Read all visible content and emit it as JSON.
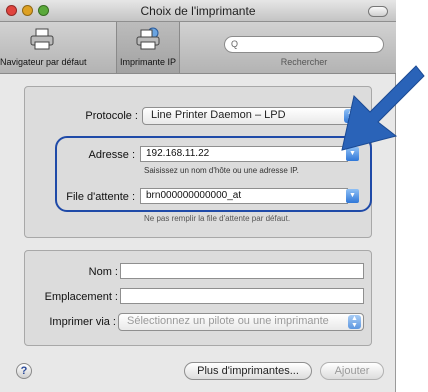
{
  "window": {
    "title": "Choix de l'imprimante"
  },
  "toolbar": {
    "default_browser_label": "Navigateur par défaut",
    "ip_printer_label": "Imprimante IP",
    "search_label": "Rechercher",
    "search_placeholder": "Q"
  },
  "form": {
    "protocol_label": "Protocole :",
    "protocol_value": "Line Printer Daemon – LPD",
    "address_label": "Adresse :",
    "address_value": "192.168.11.22",
    "address_hint": "Saisissez un nom d'hôte ou une adresse IP.",
    "queue_label": "File d'attente :",
    "queue_value": "brn000000000000_at",
    "queue_hint": "Ne pas remplir la file d'attente par défaut."
  },
  "details": {
    "name_label": "Nom :",
    "name_value": "",
    "location_label": "Emplacement :",
    "location_value": "",
    "print_via_label": "Imprimer via :",
    "print_via_value": "Sélectionnez un pilote ou une imprimante"
  },
  "buttons": {
    "more_printers_label": "Plus d'imprimantes...",
    "add_label": "Ajouter",
    "help_label": "?"
  },
  "colors": {
    "highlight": "#1f4aa8",
    "arrow": "#2a63b8",
    "popup_arrow": "#2f77d8"
  },
  "icons": {
    "window_close": "red-traffic-light",
    "window_minimize": "yellow-traffic-light",
    "window_zoom": "green-traffic-light",
    "default_browser": "printer-icon",
    "ip_printer": "globe-printer-icon",
    "search": "magnifier-icon",
    "callout": "arrow-icon"
  }
}
